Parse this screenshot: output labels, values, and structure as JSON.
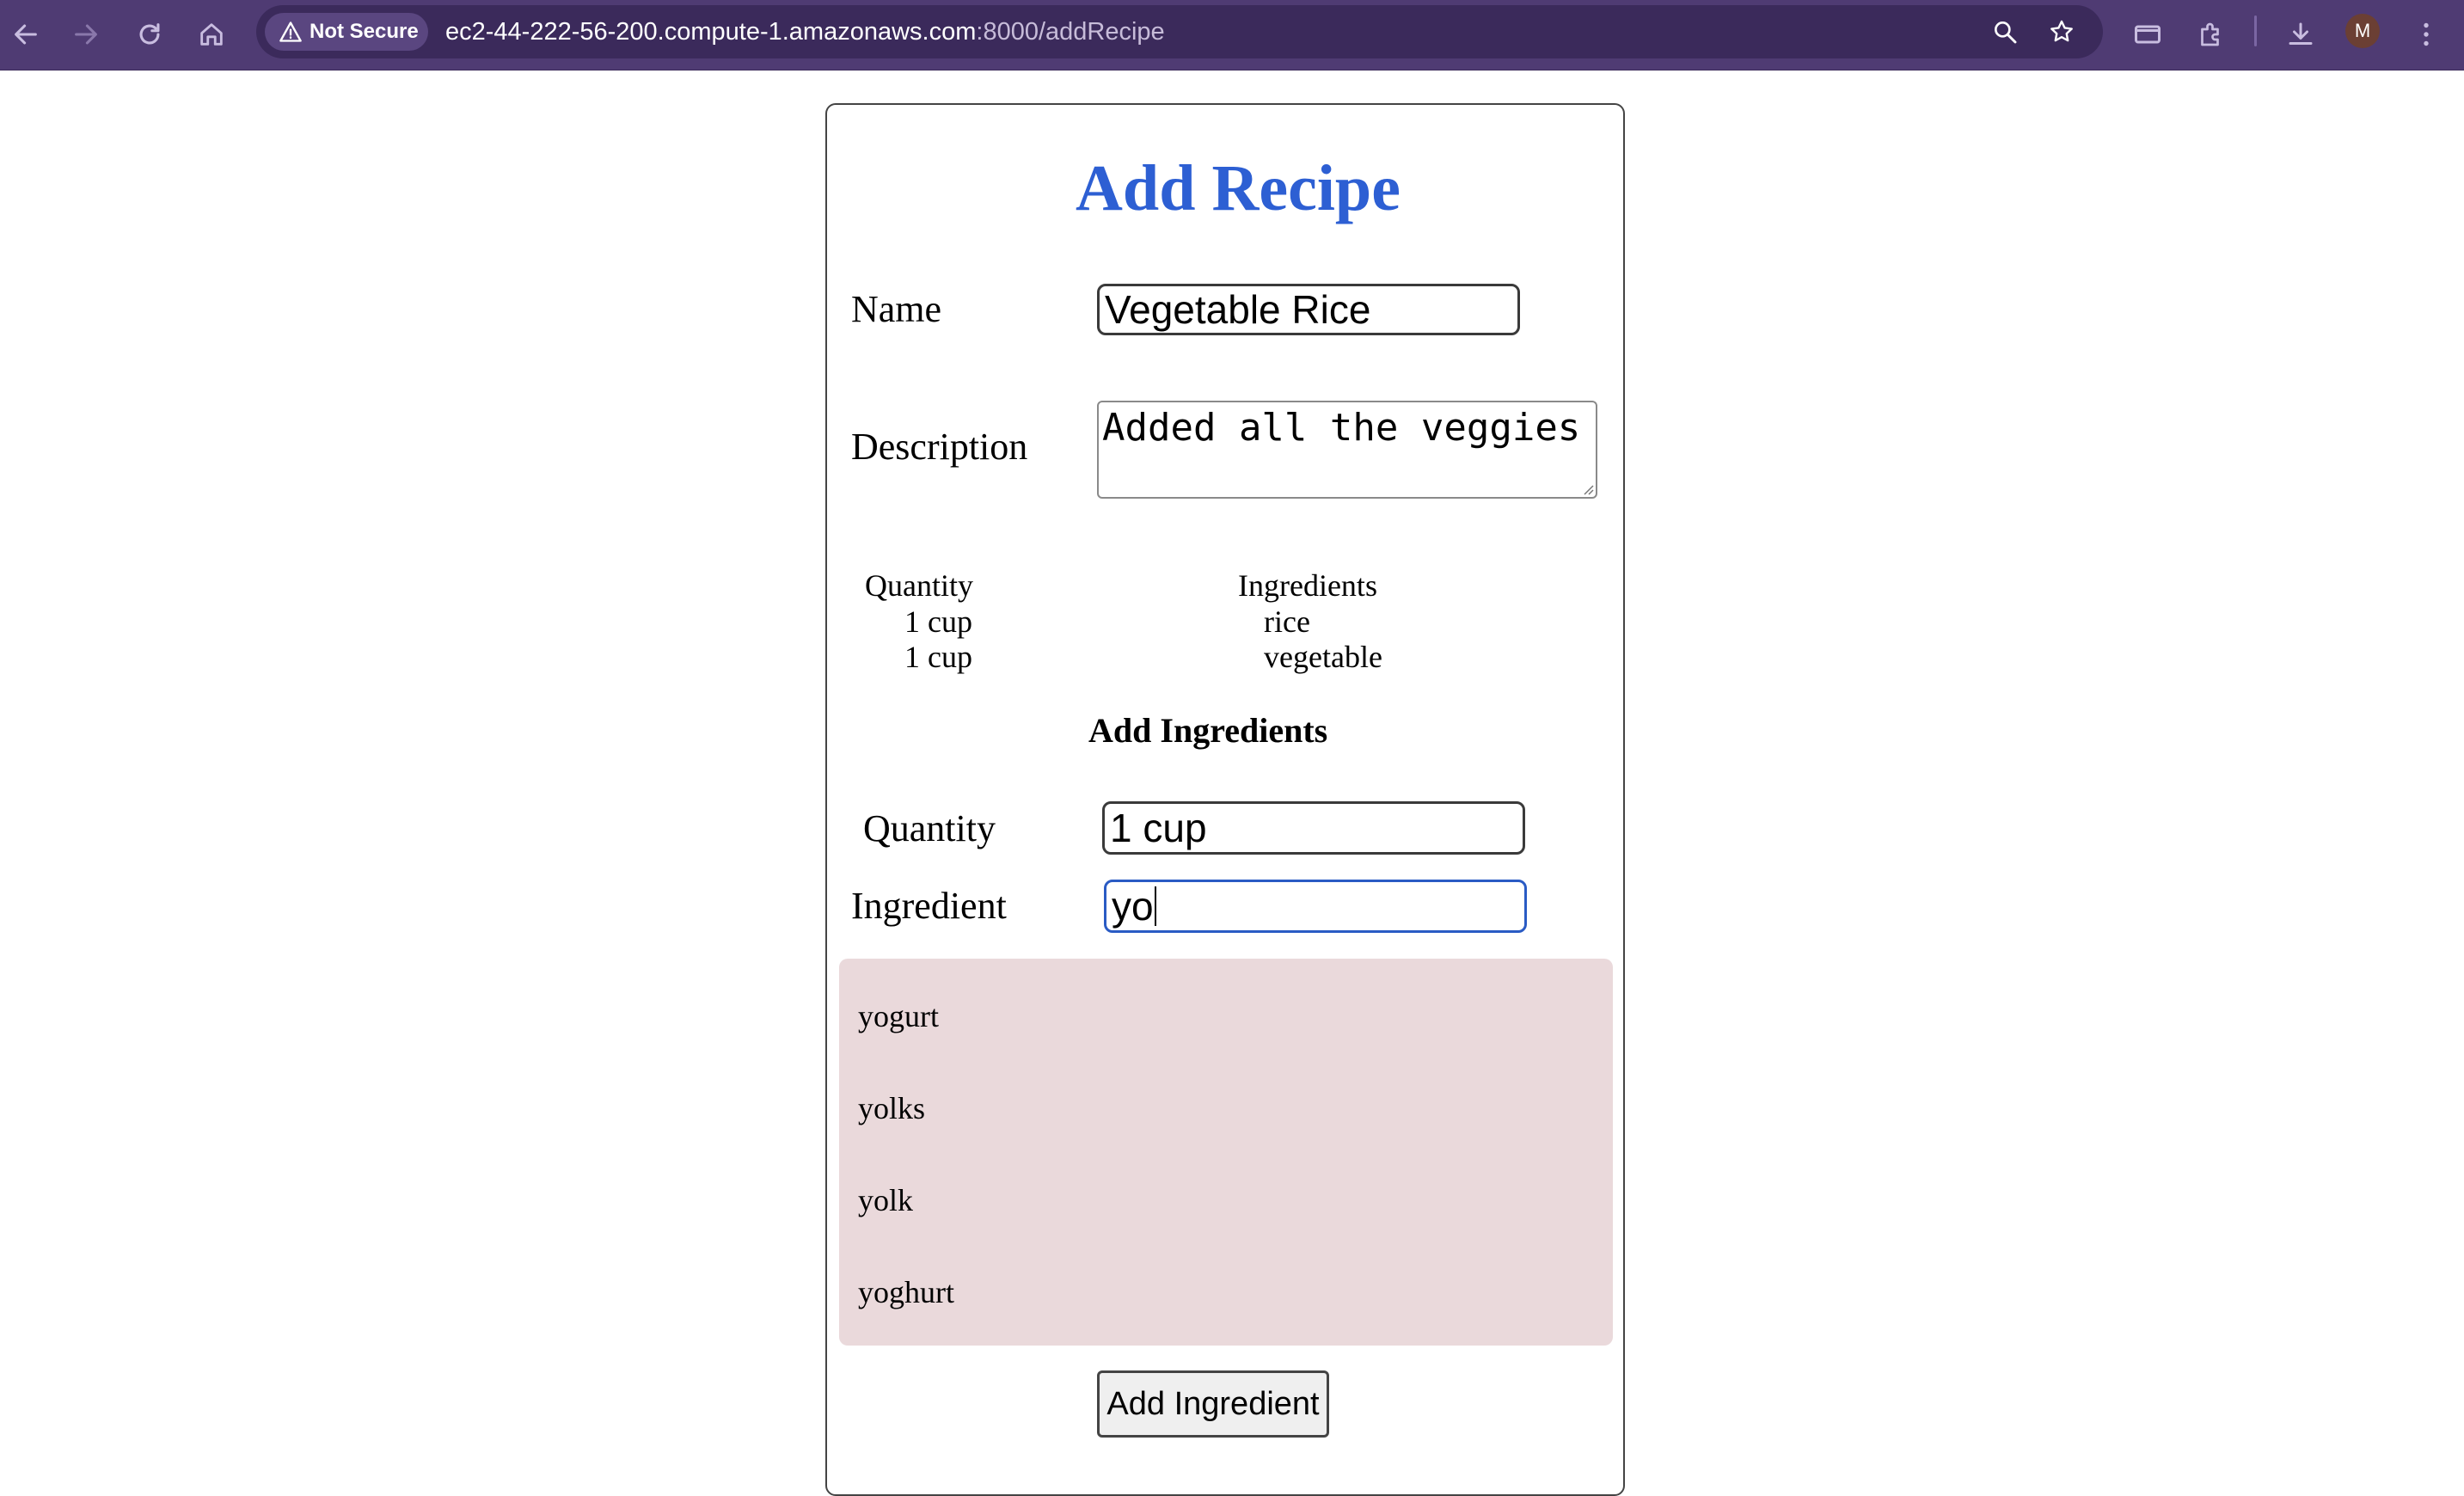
{
  "browser": {
    "security_label": "Not Secure",
    "url_host": "ec2-44-222-56-200.compute-1.amazonaws.com",
    "url_path": ":8000/addRecipe",
    "profile_initial": "M"
  },
  "page": {
    "title": "Add Recipe",
    "name_label": "Name",
    "name_value": "Vegetable Rice",
    "description_label": "Description",
    "description_value": "Added all the veggies",
    "table": {
      "quantity_header": "Quantity",
      "ingredients_header": "Ingredients",
      "rows": [
        {
          "quantity": "1 cup",
          "ingredient": "rice"
        },
        {
          "quantity": "1 cup",
          "ingredient": "vegetable"
        }
      ]
    },
    "add_ingredients_heading": "Add Ingredients",
    "quantity_label": "Quantity",
    "quantity_value": "1 cup",
    "ingredient_label": "Ingredient",
    "ingredient_value": "yo",
    "suggestions": [
      "yogurt",
      "yolks",
      "yolk",
      "yoghurt"
    ],
    "add_button_label": "Add Ingredient"
  },
  "colors": {
    "chrome_bg": "#4f3b73",
    "title": "#2d5fd3",
    "suggestion_bg": "#ead9db",
    "focus_border": "#2a5bc4"
  }
}
